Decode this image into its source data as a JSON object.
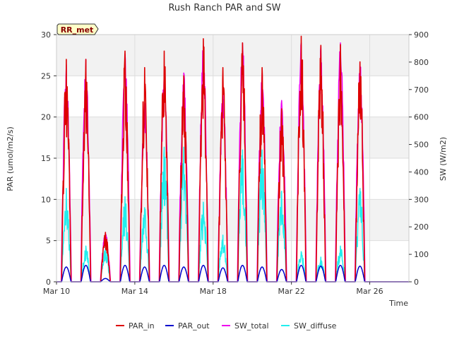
{
  "chart_data": {
    "type": "line",
    "title": "Rush Ranch PAR and SW",
    "xlabel": "Time",
    "ylabel_left": "PAR (umol/m2/s)",
    "ylabel_right": "SW (W/m2)",
    "site_badge": "RR_met",
    "x_start": "2024-03-10",
    "ylim_left": [
      0,
      30
    ],
    "ylim_right": [
      0,
      900
    ],
    "xlim_days": [
      0,
      18
    ],
    "x_ticks": [
      {
        "day": 0,
        "label": "Mar 10"
      },
      {
        "day": 4,
        "label": "Mar 14"
      },
      {
        "day": 8,
        "label": "Mar 18"
      },
      {
        "day": 12,
        "label": "Mar 22"
      },
      {
        "day": 16,
        "label": "Mar 26"
      }
    ],
    "y_ticks_left": [
      "0",
      "5",
      "10",
      "15",
      "20",
      "25",
      "30"
    ],
    "y_ticks_right": [
      "0",
      "100",
      "200",
      "300",
      "400",
      "500",
      "600",
      "700",
      "800",
      "900"
    ],
    "grid": true,
    "legend_position": "bottom",
    "daily_peaks": {
      "days": [
        "Mar 10",
        "Mar 11",
        "Mar 12",
        "Mar 13",
        "Mar 14",
        "Mar 15",
        "Mar 16",
        "Mar 17",
        "Mar 18",
        "Mar 19",
        "Mar 20",
        "Mar 21",
        "Mar 22",
        "Mar 23",
        "Mar 24",
        "Mar 25",
        "Mar 26",
        "Mar 27"
      ],
      "PAR_in": [
        27.0,
        27.0,
        6.0,
        28.0,
        26.0,
        28.0,
        25.0,
        29.5,
        26.0,
        29.0,
        26.0,
        21.0,
        29.8,
        28.7,
        28.8,
        26.7,
        0,
        0
      ],
      "PAR_out": [
        1.8,
        2.0,
        0.4,
        2.0,
        1.8,
        2.0,
        1.8,
        2.0,
        1.7,
        2.0,
        1.8,
        1.5,
        2.0,
        1.9,
        2.0,
        1.9,
        0,
        0
      ],
      "SW_total": [
        790,
        810,
        180,
        830,
        650,
        760,
        760,
        860,
        700,
        870,
        760,
        660,
        870,
        860,
        870,
        800,
        0,
        0
      ],
      "SW_diffuse": [
        340,
        130,
        130,
        310,
        270,
        490,
        490,
        290,
        170,
        480,
        480,
        330,
        110,
        90,
        130,
        340,
        0,
        0
      ]
    },
    "series": [
      {
        "name": "PAR_in",
        "color": "#dd0000",
        "axis": "left"
      },
      {
        "name": "PAR_out",
        "color": "#0000cc",
        "axis": "left"
      },
      {
        "name": "SW_total",
        "color": "#ee00ee",
        "axis": "right"
      },
      {
        "name": "SW_diffuse",
        "color": "#22eeee",
        "axis": "right"
      }
    ]
  }
}
